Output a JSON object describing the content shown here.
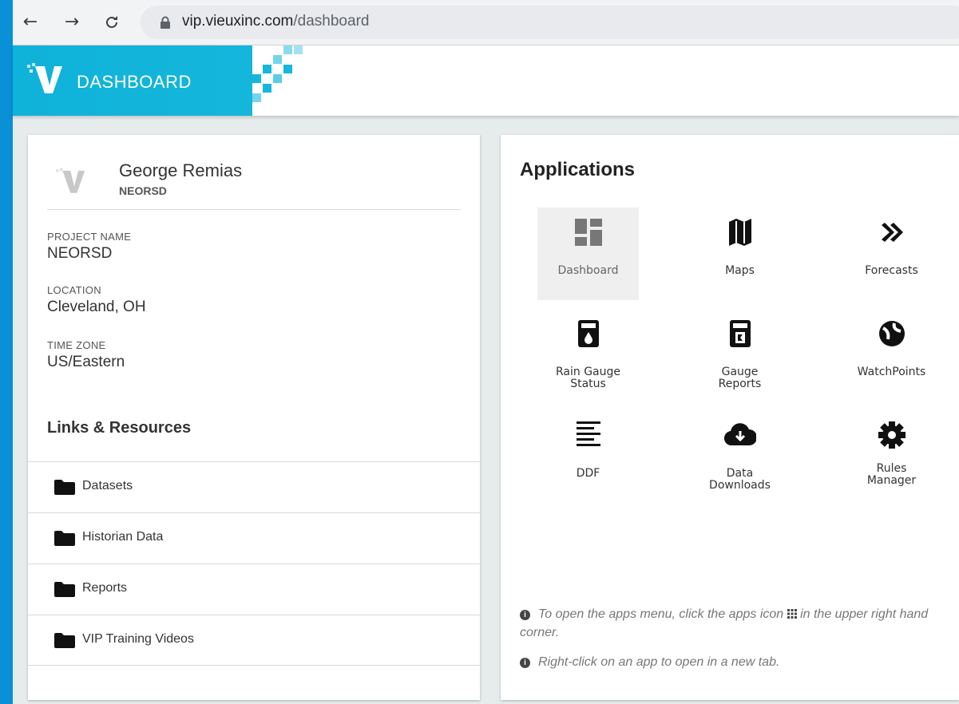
{
  "browser": {
    "url_host": "vip.vieuxinc.com",
    "url_path": "/dashboard"
  },
  "header": {
    "title": "DASHBOARD"
  },
  "profile": {
    "name": "George Remias",
    "org": "NEORSD",
    "fields": [
      {
        "label": "PROJECT NAME",
        "value": "NEORSD"
      },
      {
        "label": "LOCATION",
        "value": "Cleveland, OH"
      },
      {
        "label": "TIME ZONE",
        "value": "US/Eastern"
      }
    ]
  },
  "links": {
    "heading": "Links & Resources",
    "items": [
      {
        "label": "Datasets"
      },
      {
        "label": "Historian Data"
      },
      {
        "label": "Reports"
      },
      {
        "label": "VIP Training Videos"
      }
    ]
  },
  "applications": {
    "heading": "Applications",
    "items": [
      {
        "label": "Dashboard",
        "icon": "dashboard-icon"
      },
      {
        "label": "Maps",
        "icon": "map-icon"
      },
      {
        "label": "Forecasts",
        "icon": "double-chevron-right-icon"
      },
      {
        "label": "Rain Gauge\nStatus",
        "icon": "rain-gauge-icon"
      },
      {
        "label": "Gauge\nReports",
        "icon": "gauge-report-icon"
      },
      {
        "label": "WatchPoints",
        "icon": "watchpoints-icon"
      },
      {
        "label": "DDF",
        "icon": "align-left-icon"
      },
      {
        "label": "Data\nDownloads",
        "icon": "cloud-download-icon"
      },
      {
        "label": "Rules\nManager",
        "icon": "cog-icon"
      }
    ],
    "hints": [
      {
        "before": "To open the apps menu, click the apps icon",
        "after": "in the upper right hand corner."
      },
      {
        "text": "Right-click on an app to open in a new tab."
      }
    ]
  },
  "colors": {
    "brand": "#16b7dc",
    "page_bg": "#0a90d6"
  }
}
